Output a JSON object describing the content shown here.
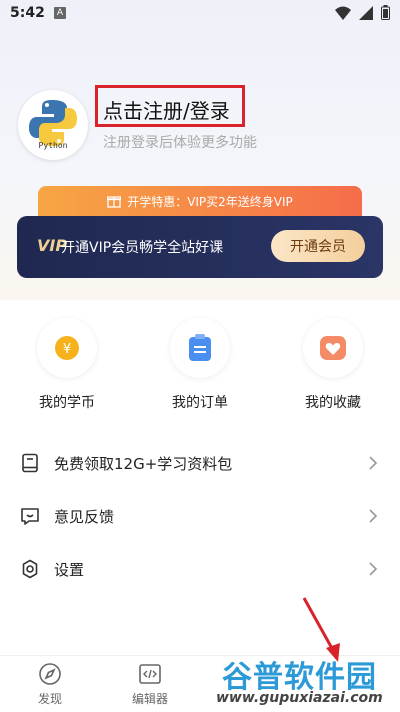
{
  "status_bar": {
    "time": "5:42",
    "notif_letter": "A"
  },
  "profile": {
    "avatar_text": "Python",
    "login_title": "点击注册/登录",
    "login_subtitle": "注册登录后体验更多功能"
  },
  "promo": {
    "text": "开学特惠：VIP买2年送终身VIP"
  },
  "vip": {
    "logo": "VIP",
    "text": "开通VIP会员畅学全站好课",
    "button": "开通会员"
  },
  "quick_actions": [
    {
      "label": "我的学币",
      "icon": "coin-icon"
    },
    {
      "label": "我的订单",
      "icon": "clipboard-icon"
    },
    {
      "label": "我的收藏",
      "icon": "heart-icon"
    }
  ],
  "menu": [
    {
      "label": "免费领取12G+学习资料包",
      "icon": "book-icon"
    },
    {
      "label": "意见反馈",
      "icon": "feedback-icon"
    },
    {
      "label": "设置",
      "icon": "gear-icon"
    }
  ],
  "bottom_nav": [
    {
      "label": "发现",
      "icon": "compass-icon"
    },
    {
      "label": "编辑器",
      "icon": "code-icon"
    }
  ],
  "watermark": {
    "brand": "谷普软件园",
    "url": "www.gupuxiazai.com"
  },
  "colors": {
    "accent": "#d8232a",
    "vip_bg": "#1f2850",
    "promo_start": "#f7a644",
    "promo_end": "#f56d4a"
  }
}
